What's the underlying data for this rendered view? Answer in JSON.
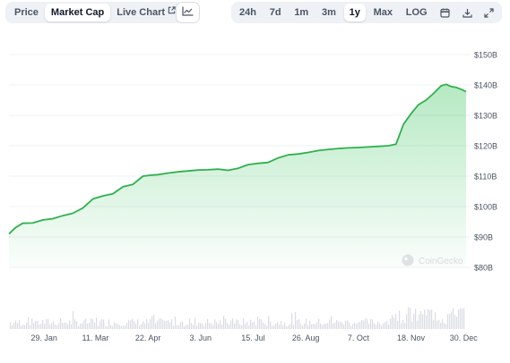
{
  "toolbar": {
    "view_tabs": [
      {
        "label": "Price",
        "active": false
      },
      {
        "label": "Market Cap",
        "active": true
      },
      {
        "label": "Live Chart",
        "active": false
      }
    ],
    "chart_type_icon": "line-chart-icon",
    "ranges": [
      {
        "label": "24h",
        "active": false
      },
      {
        "label": "7d",
        "active": false
      },
      {
        "label": "1m",
        "active": false
      },
      {
        "label": "3m",
        "active": false
      },
      {
        "label": "1y",
        "active": true
      },
      {
        "label": "Max",
        "active": false
      },
      {
        "label": "LOG",
        "active": false
      }
    ],
    "tool_icons": [
      "calendar-icon",
      "download-icon",
      "expand-icon"
    ]
  },
  "watermark": "CoinGecko",
  "colors": {
    "line": "#2fb14e",
    "fill": "#5ccf7a",
    "grid": "#edf0f3",
    "axis_text": "#4b5563",
    "volume": "#d9dde3"
  },
  "chart_data": {
    "type": "area",
    "title": "",
    "xlabel": "",
    "ylabel": "",
    "ylim": [
      80,
      150
    ],
    "grid": true,
    "y_ticks": [
      {
        "value": 80,
        "label": "$80B"
      },
      {
        "value": 90,
        "label": "$90B"
      },
      {
        "value": 100,
        "label": "$100B"
      },
      {
        "value": 110,
        "label": "$110B"
      },
      {
        "value": 120,
        "label": "$120B"
      },
      {
        "value": 130,
        "label": "$130B"
      },
      {
        "value": 140,
        "label": "$140B"
      },
      {
        "value": 150,
        "label": "$150B"
      }
    ],
    "x_ticks": [
      "29. Jan",
      "11. Mar",
      "22. Apr",
      "3. Jun",
      "15. Jul",
      "26. Aug",
      "7. Oct",
      "18. Nov",
      "30. Dec"
    ],
    "x_tick_days": [
      29,
      70,
      112,
      154,
      196,
      238,
      280,
      322,
      364
    ],
    "series": [
      {
        "x": [
          1,
          6,
          12,
          20,
          28,
          36,
          44,
          52,
          60,
          68,
          76,
          84,
          92,
          100,
          108,
          114,
          120,
          128,
          136,
          144,
          152,
          160,
          168,
          176,
          184,
          192,
          200,
          208,
          216,
          224,
          232,
          240,
          248,
          256,
          264,
          272,
          280,
          288,
          296,
          304,
          310,
          316,
          322,
          328,
          334,
          340,
          346,
          350,
          354,
          358,
          362,
          366
        ],
        "values": [
          91,
          93,
          94.5,
          94.6,
          95.6,
          96,
          97,
          97.8,
          99.5,
          102.5,
          103.5,
          104.2,
          106.5,
          107.3,
          110,
          110.3,
          110.5,
          111,
          111.4,
          111.7,
          112,
          112.1,
          112.3,
          111.9,
          112.6,
          113.8,
          114.2,
          114.5,
          116,
          117,
          117.3,
          117.8,
          118.4,
          118.8,
          119.1,
          119.3,
          119.4,
          119.6,
          119.8,
          120,
          120.5,
          127,
          130.5,
          133.5,
          135,
          137.2,
          139.7,
          140.2,
          139.5,
          139.2,
          138.6,
          137.8
        ]
      }
    ]
  }
}
